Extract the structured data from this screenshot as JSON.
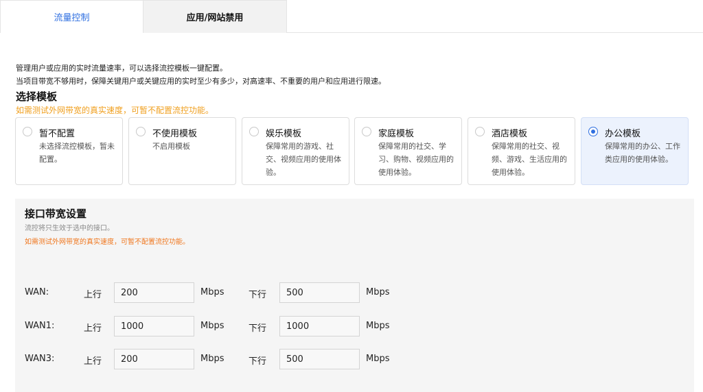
{
  "tabs": [
    {
      "label": "流量控制",
      "active": true
    },
    {
      "label": "应用/网站禁用",
      "active": false
    }
  ],
  "description": {
    "line1": "管理用户或应用的实时流量速率，可以选择流控模板一键配置。",
    "line2": "当项目带宽不够用时，保障关键用户或关键应用的实时至少有多少，对高速率、不重要的用户和应用进行限速。"
  },
  "template_section": {
    "title": "选择模板",
    "warning": "如需测试外网带宽的真实速度，可暂不配置流控功能。",
    "cards": [
      {
        "title": "暂不配置",
        "desc": "未选择流控模板，暂未配置。",
        "selected": false
      },
      {
        "title": "不使用模板",
        "desc": "不启用模板",
        "selected": false
      },
      {
        "title": "娱乐模板",
        "desc": "保障常用的游戏、社交、视频应用的使用体验。",
        "selected": false
      },
      {
        "title": "家庭模板",
        "desc": "保障常用的社交、学习、购物、视频应用的使用体验。",
        "selected": false
      },
      {
        "title": "酒店模板",
        "desc": "保障常用的社交、视频、游戏、生活应用的使用体验。",
        "selected": false
      },
      {
        "title": "办公模板",
        "desc": "保障常用的办公、工作类应用的使用体验。",
        "selected": true
      }
    ]
  },
  "bandwidth": {
    "title": "接口带宽设置",
    "subtitle": "流控将只生效于选中的接口。",
    "warning": "如需测试外网带宽的真实速度，可暂不配置流控功能。",
    "up_label": "上行",
    "down_label": "下行",
    "unit": "Mbps",
    "rows": [
      {
        "name": "WAN:",
        "up": "200",
        "down": "500"
      },
      {
        "name": "WAN1:",
        "up": "1000",
        "down": "1000"
      },
      {
        "name": "WAN3:",
        "up": "200",
        "down": "500"
      }
    ]
  },
  "colors": {
    "accent": "#2f6fe0",
    "warning": "#f0a020",
    "selected_card_bg": "#ecf2fd"
  }
}
